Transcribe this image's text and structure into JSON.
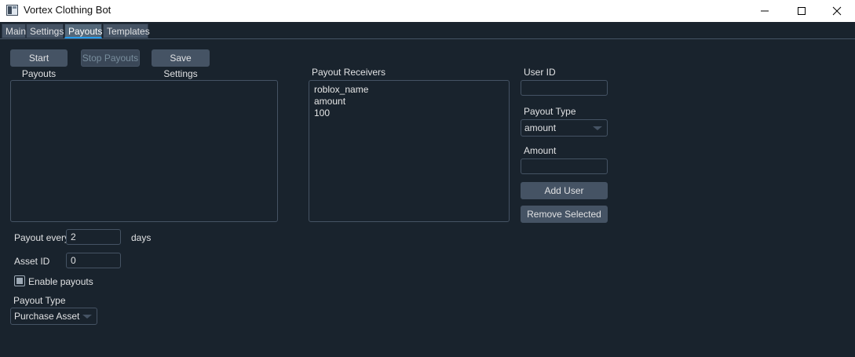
{
  "window": {
    "title": "Vortex Clothing Bot"
  },
  "tabs": [
    {
      "label": "Main"
    },
    {
      "label": "Settings"
    },
    {
      "label": "Payouts",
      "active": true
    },
    {
      "label": "Templates"
    }
  ],
  "toolbar": {
    "start_label": "Start Payouts",
    "stop_label": "Stop Payouts",
    "save_label": "Save Settings"
  },
  "settings": {
    "payout_every_label": "Payout every",
    "payout_every_value": "2",
    "days_label": "days",
    "asset_id_label": "Asset ID",
    "asset_id_value": "0",
    "enable_payouts_label": "Enable payouts",
    "enable_payouts_checked": true,
    "payout_type_label": "Payout Type",
    "payout_type_value": "Purchase Asset"
  },
  "receivers": {
    "title": "Payout Receivers",
    "lines": [
      "roblox_name",
      "amount",
      "100"
    ]
  },
  "user_form": {
    "user_id_label": "User ID",
    "user_id_value": "",
    "payout_type_label": "Payout Type",
    "payout_type_value": "amount",
    "amount_label": "Amount",
    "amount_value": "",
    "add_user_label": "Add User",
    "remove_selected_label": "Remove Selected"
  },
  "colors": {
    "background": "#19232d",
    "control": "#455364",
    "accent": "#259ae9"
  },
  "icons": [
    "app-icon",
    "minimize-icon",
    "maximize-icon",
    "close-icon",
    "chevron-down-icon"
  ]
}
